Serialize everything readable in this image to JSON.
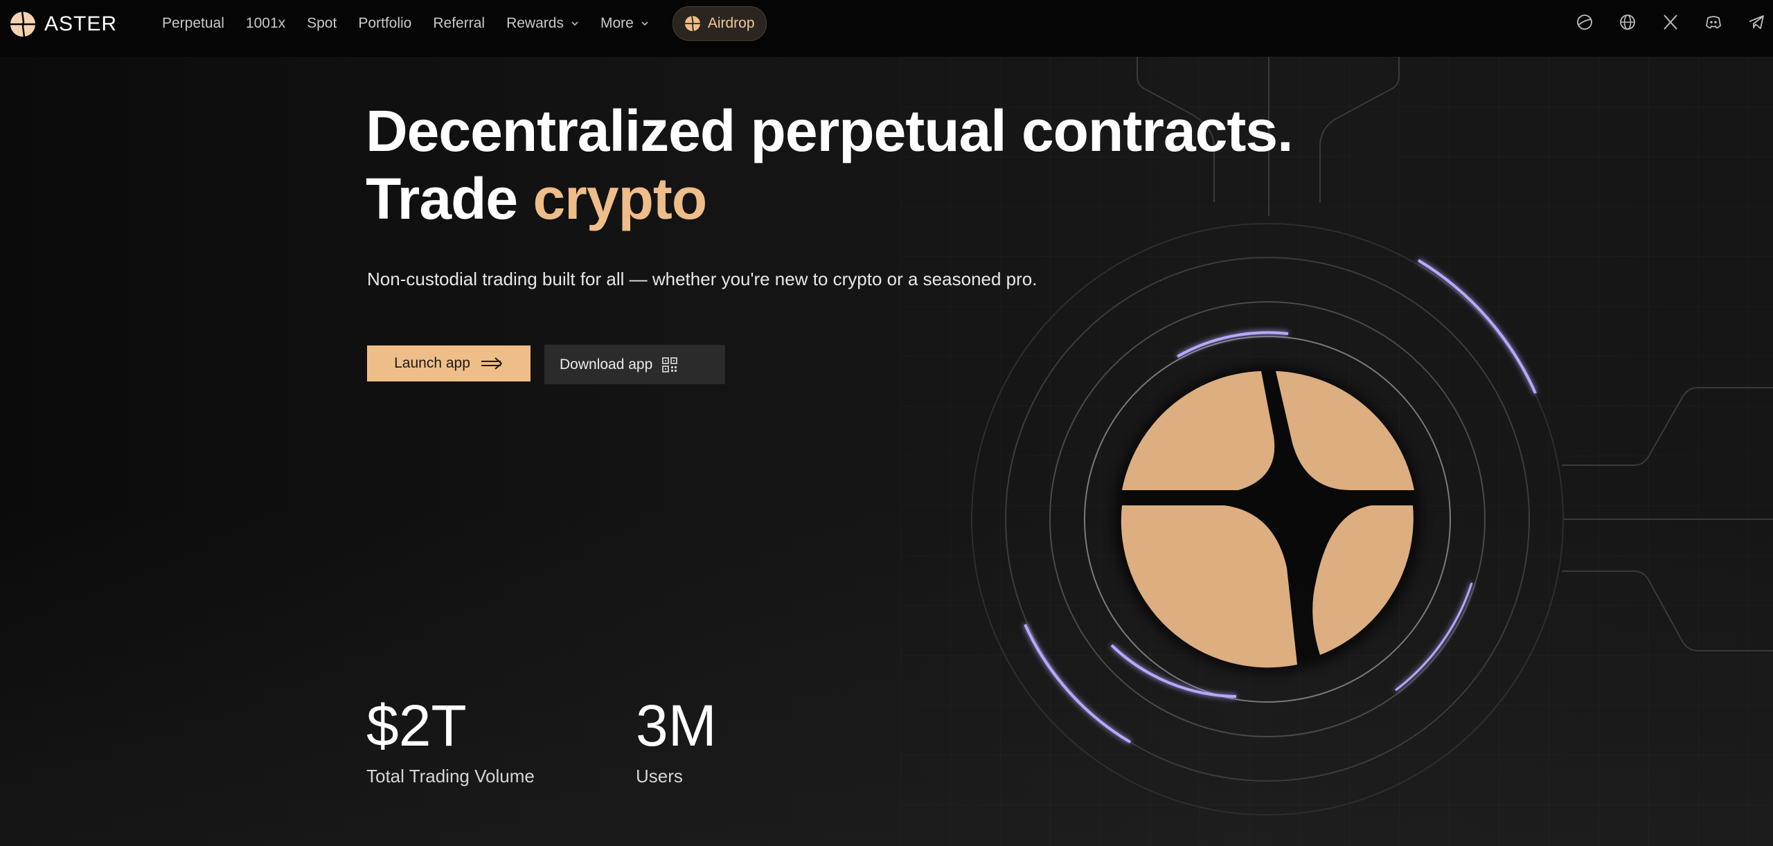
{
  "brand": {
    "name": "ASTER",
    "accent_color": "#eebd8a",
    "highlight_color": "#b8a8ff"
  },
  "nav": {
    "links": [
      {
        "label": "Perpetual"
      },
      {
        "label": "1001x"
      },
      {
        "label": "Spot"
      },
      {
        "label": "Portfolio"
      },
      {
        "label": "Referral"
      },
      {
        "label": "Rewards",
        "dropdown": true
      },
      {
        "label": "More",
        "dropdown": true
      }
    ],
    "airdrop_label": "Airdrop",
    "icons": [
      "theme-icon",
      "globe-icon",
      "x-icon",
      "discord-icon",
      "telegram-icon"
    ]
  },
  "hero": {
    "title_line1": "Decentralized perpetual contracts.",
    "title_line2_prefix": "Trade",
    "title_line2_accent": "crypto",
    "subtitle": "Non-custodial trading built for all — whether you're new to crypto or a seasoned pro.",
    "launch_label": "Launch app",
    "download_label": "Download app"
  },
  "stats": [
    {
      "value": "$2T",
      "label": "Total Trading Volume"
    },
    {
      "value": "3M",
      "label": "Users"
    }
  ]
}
